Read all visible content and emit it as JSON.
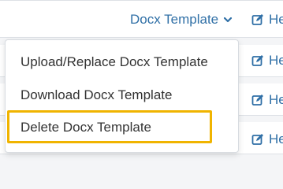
{
  "dropdown": {
    "label": "Docx Template",
    "icon": "chevron-down-icon",
    "items": [
      {
        "label": "Upload/Replace Docx Template"
      },
      {
        "label": "Download Docx Template"
      },
      {
        "label": "Delete Docx Template"
      }
    ]
  },
  "help_links": [
    {
      "label": "He",
      "icon": "edit-icon"
    },
    {
      "label": "He",
      "icon": "edit-icon"
    },
    {
      "label": "He",
      "icon": "edit-icon"
    },
    {
      "label": "He",
      "icon": "edit-icon"
    }
  ],
  "colors": {
    "link": "#2f6fa6",
    "highlight": "#f0b400",
    "menu_text": "#333333"
  }
}
